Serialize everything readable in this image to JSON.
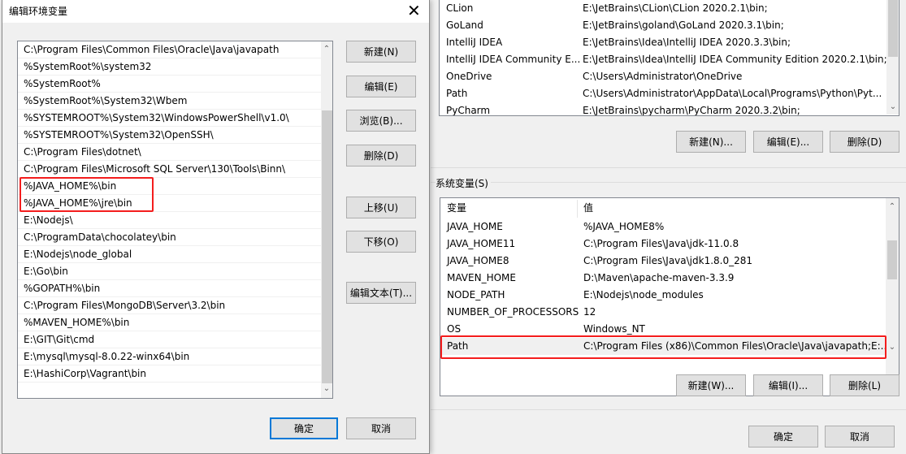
{
  "edit_dialog": {
    "title": "编辑环境变量",
    "close_icon": "close-icon",
    "items": [
      "C:\\Program Files\\Common Files\\Oracle\\Java\\javapath",
      "%SystemRoot%\\system32",
      "%SystemRoot%",
      "%SystemRoot%\\System32\\Wbem",
      "%SYSTEMROOT%\\System32\\WindowsPowerShell\\v1.0\\",
      "%SYSTEMROOT%\\System32\\OpenSSH\\",
      "C:\\Program Files\\dotnet\\",
      "C:\\Program Files\\Microsoft SQL Server\\130\\Tools\\Binn\\",
      "%JAVA_HOME%\\bin",
      "%JAVA_HOME%\\jre\\bin",
      "E:\\Nodejs\\",
      "C:\\ProgramData\\chocolatey\\bin",
      "E:\\Nodejs\\node_global",
      "E:\\Go\\bin",
      "%GOPATH%\\bin",
      "C:\\Program Files\\MongoDB\\Server\\3.2\\bin",
      "%MAVEN_HOME%\\bin",
      "E:\\GIT\\Git\\cmd",
      "E:\\mysql\\mysql-8.0.22-winx64\\bin",
      "E:\\HashiCorp\\Vagrant\\bin"
    ],
    "buttons": {
      "new": "新建(N)",
      "edit": "编辑(E)",
      "browse": "浏览(B)...",
      "delete": "删除(D)",
      "move_up": "上移(U)",
      "move_down": "下移(O)",
      "edit_text": "编辑文本(T)...",
      "ok": "确定",
      "cancel": "取消"
    }
  },
  "user_vars": {
    "rows": [
      [
        "CLion",
        "E:\\JetBrains\\CLion\\CLion 2020.2.1\\bin;"
      ],
      [
        "GoLand",
        "E:\\JetBrains\\goland\\GoLand 2020.3.1\\bin;"
      ],
      [
        "IntelliJ IDEA",
        "E:\\JetBrains\\Idea\\IntelliJ IDEA 2020.3.3\\bin;"
      ],
      [
        "IntelliJ IDEA Community E...",
        "E:\\JetBrains\\Idea\\IntelliJ IDEA Community Edition 2020.2.1\\bin;"
      ],
      [
        "OneDrive",
        "C:\\Users\\Administrator\\OneDrive"
      ],
      [
        "Path",
        "C:\\Users\\Administrator\\AppData\\Local\\Programs\\Python\\Pyt..."
      ],
      [
        "PyCharm",
        "E:\\JetBrains\\pycharm\\PyCharm 2020.3.2\\bin;"
      ]
    ],
    "buttons": {
      "new": "新建(N)...",
      "edit": "编辑(E)...",
      "delete": "删除(D)"
    }
  },
  "system_vars": {
    "group_label": "系统变量(S)",
    "headers": {
      "name": "变量",
      "value": "值"
    },
    "rows": [
      [
        "JAVA_HOME",
        "%JAVA_HOME8%"
      ],
      [
        "JAVA_HOME11",
        "C:\\Program Files\\Java\\jdk-11.0.8"
      ],
      [
        "JAVA_HOME8",
        "C:\\Program Files\\Java\\jdk1.8.0_281"
      ],
      [
        "MAVEN_HOME",
        "D:\\Maven\\apache-maven-3.3.9"
      ],
      [
        "NODE_PATH",
        "E:\\Nodejs\\node_modules"
      ],
      [
        "NUMBER_OF_PROCESSORS",
        "12"
      ],
      [
        "OS",
        "Windows_NT"
      ],
      [
        "Path",
        "C:\\Program Files (x86)\\Common Files\\Oracle\\Java\\javapath;E:..."
      ]
    ],
    "selected": "Path",
    "buttons": {
      "new": "新建(W)...",
      "edit": "编辑(I)...",
      "delete": "删除(L)"
    }
  },
  "footer": {
    "ok": "确定",
    "cancel": "取消"
  },
  "colors": {
    "highlight_box": "#f41d1d",
    "default_button_border": "#0078d7"
  }
}
